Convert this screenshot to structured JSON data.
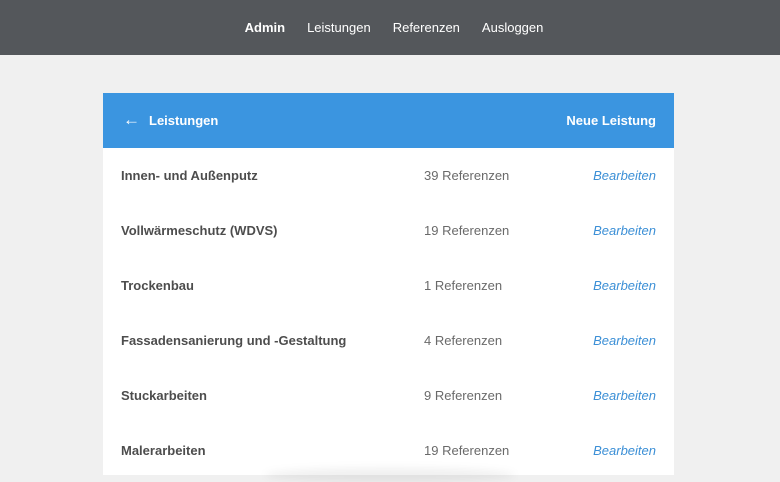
{
  "nav": {
    "items": [
      {
        "label": "Admin",
        "active": true
      },
      {
        "label": "Leistungen",
        "active": false
      },
      {
        "label": "Referenzen",
        "active": false
      },
      {
        "label": "Ausloggen",
        "active": false
      }
    ]
  },
  "panel": {
    "back_icon": "arrow-left-icon",
    "title": "Leistungen",
    "new_label": "Neue Leistung",
    "rows": [
      {
        "name": "Innen- und Außenputz",
        "count": "39 Referenzen",
        "edit": "Bearbeiten"
      },
      {
        "name": "Vollwärmeschutz (WDVS)",
        "count": "19 Referenzen",
        "edit": "Bearbeiten"
      },
      {
        "name": "Trockenbau",
        "count": "1 Referenzen",
        "edit": "Bearbeiten"
      },
      {
        "name": "Fassadensanierung und -Gestaltung",
        "count": "4 Referenzen",
        "edit": "Bearbeiten"
      },
      {
        "name": "Stuckarbeiten",
        "count": "9 Referenzen",
        "edit": "Bearbeiten"
      },
      {
        "name": "Malerarbeiten",
        "count": "19 Referenzen",
        "edit": "Bearbeiten"
      }
    ]
  },
  "colors": {
    "topbar": "#54575b",
    "accent": "#3b95e0",
    "link": "#3b8fd6",
    "background": "#f0f0f0"
  }
}
